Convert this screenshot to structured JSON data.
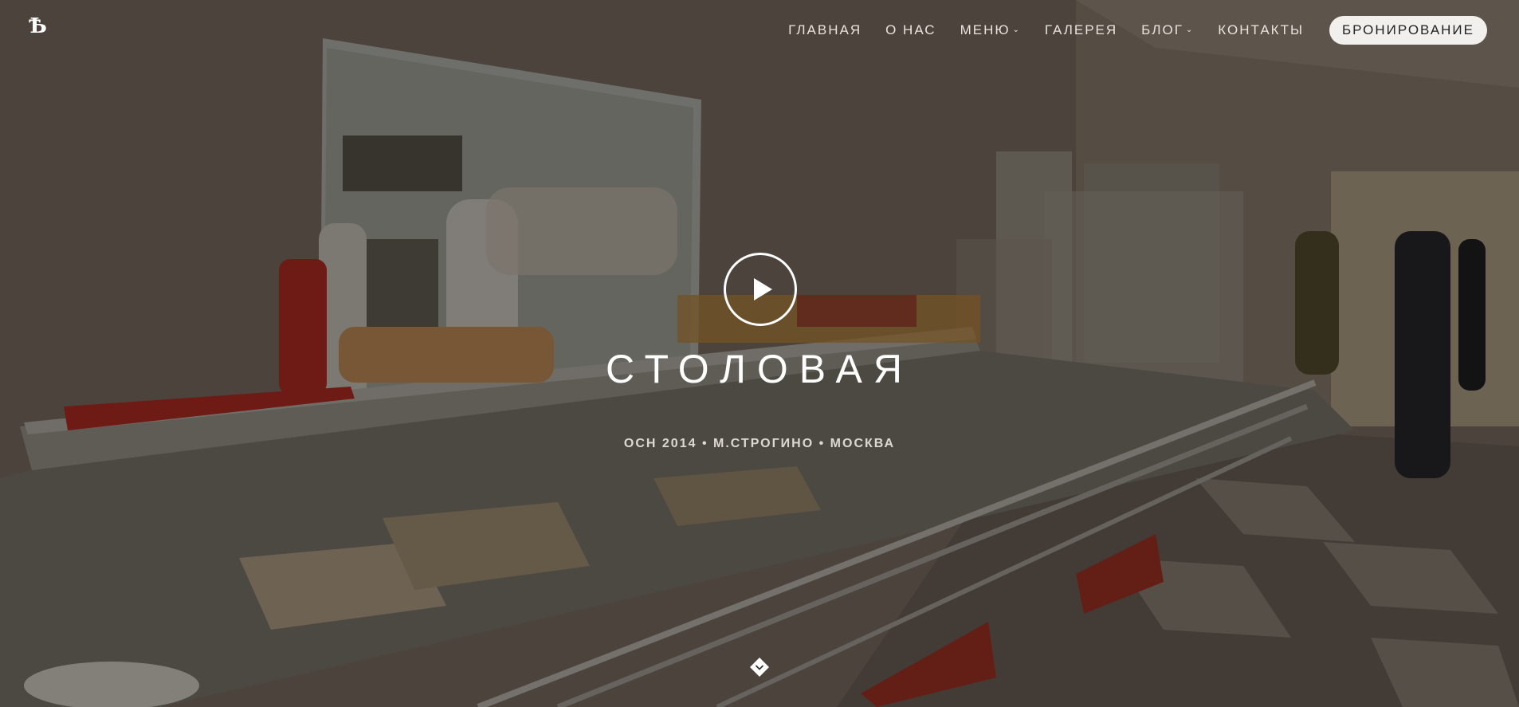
{
  "nav": {
    "logo_text": "Ѣ",
    "items": [
      {
        "label": "ГЛАВНАЯ",
        "dropdown": false
      },
      {
        "label": "О НАС",
        "dropdown": false
      },
      {
        "label": "МЕНЮ",
        "dropdown": true
      },
      {
        "label": "ГАЛЕРЕЯ",
        "dropdown": false
      },
      {
        "label": "БЛОГ",
        "dropdown": true
      },
      {
        "label": "КОНТАКТЫ",
        "dropdown": false
      }
    ],
    "book_label": "БРОНИРОВАНИЕ"
  },
  "hero": {
    "title": "СТОЛОВАЯ",
    "subtitle": "ОСН 2014 • М.СТРОГИНО • МОСКВА",
    "play_icon": "play-icon",
    "scroll_icon": "chevron-down-icon"
  },
  "colors": {
    "overlay": "#1c1712",
    "text": "#ffffff",
    "button_bg": "#f2f0ed",
    "accent_red": "#b8261f"
  }
}
